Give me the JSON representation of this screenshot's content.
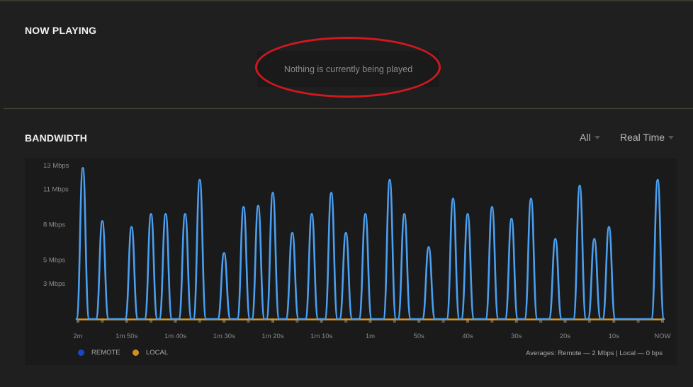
{
  "now_playing": {
    "title": "NOW PLAYING",
    "empty_message": "Nothing is currently being played"
  },
  "bandwidth": {
    "title": "BANDWIDTH",
    "filter_selected": "All",
    "range_selected": "Real Time",
    "legend": {
      "remote_label": "REMOTE",
      "local_label": "LOCAL"
    },
    "averages_text": "Averages: Remote — 2 Mbps | Local — 0 bps"
  },
  "colors": {
    "remote_line": "#4b9ff0",
    "remote_dot": "#1a47c9",
    "local_line": "#d89626",
    "local_dot": "#d68b1f",
    "highlight": "#d0191f"
  },
  "chart_data": {
    "type": "line",
    "title": "",
    "xlabel": "",
    "ylabel": "",
    "y_tick_labels": [
      "13 Mbps",
      "11 Mbps",
      "8 Mbps",
      "5 Mbps",
      "3 Mbps"
    ],
    "y_ticks": [
      13,
      11,
      8,
      5,
      3
    ],
    "ylim": [
      0,
      13
    ],
    "x_tick_labels": [
      "2m",
      "1m 50s",
      "1m 40s",
      "1m 30s",
      "1m 20s",
      "1m 10s",
      "1m",
      "50s",
      "40s",
      "30s",
      "20s",
      "10s",
      "NOW"
    ],
    "x_ticks_seconds_ago": [
      120,
      110,
      100,
      90,
      80,
      70,
      60,
      50,
      40,
      30,
      20,
      10,
      0
    ],
    "xlim_seconds_ago": [
      120,
      0
    ],
    "legend_position": "bottom-left",
    "grid": false,
    "series": [
      {
        "name": "REMOTE",
        "peaks": [
          {
            "seconds_ago": 119,
            "value": 12.8
          },
          {
            "seconds_ago": 115,
            "value": 8.3
          },
          {
            "seconds_ago": 109,
            "value": 7.8
          },
          {
            "seconds_ago": 105,
            "value": 8.9
          },
          {
            "seconds_ago": 102,
            "value": 8.9
          },
          {
            "seconds_ago": 98,
            "value": 8.9
          },
          {
            "seconds_ago": 95,
            "value": 11.8
          },
          {
            "seconds_ago": 90,
            "value": 5.6
          },
          {
            "seconds_ago": 86,
            "value": 9.5
          },
          {
            "seconds_ago": 83,
            "value": 9.6
          },
          {
            "seconds_ago": 80,
            "value": 10.7
          },
          {
            "seconds_ago": 76,
            "value": 7.3
          },
          {
            "seconds_ago": 72,
            "value": 8.9
          },
          {
            "seconds_ago": 68,
            "value": 10.7
          },
          {
            "seconds_ago": 65,
            "value": 7.3
          },
          {
            "seconds_ago": 61,
            "value": 8.9
          },
          {
            "seconds_ago": 56,
            "value": 11.8
          },
          {
            "seconds_ago": 53,
            "value": 8.9
          },
          {
            "seconds_ago": 48,
            "value": 6.1
          },
          {
            "seconds_ago": 43,
            "value": 10.2
          },
          {
            "seconds_ago": 40,
            "value": 8.9
          },
          {
            "seconds_ago": 35,
            "value": 9.5
          },
          {
            "seconds_ago": 31,
            "value": 8.5
          },
          {
            "seconds_ago": 27,
            "value": 10.2
          },
          {
            "seconds_ago": 22,
            "value": 6.8
          },
          {
            "seconds_ago": 17,
            "value": 11.3
          },
          {
            "seconds_ago": 14,
            "value": 6.8
          },
          {
            "seconds_ago": 11,
            "value": 7.8
          },
          {
            "seconds_ago": 1,
            "value": 11.8
          }
        ],
        "baseline": 0
      },
      {
        "name": "LOCAL",
        "constant_value": 0
      }
    ]
  }
}
